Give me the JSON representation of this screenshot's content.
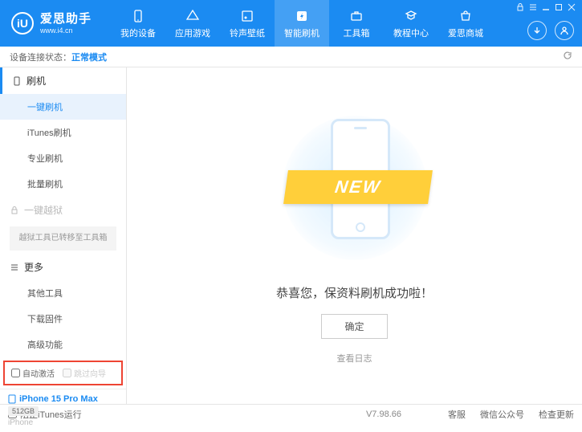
{
  "header": {
    "logo_letter": "iU",
    "title": "爱思助手",
    "url": "www.i4.cn",
    "nav": [
      {
        "label": "我的设备"
      },
      {
        "label": "应用游戏"
      },
      {
        "label": "铃声壁纸"
      },
      {
        "label": "智能刷机"
      },
      {
        "label": "工具箱"
      },
      {
        "label": "教程中心"
      },
      {
        "label": "爱思商城"
      }
    ]
  },
  "status": {
    "prefix": "设备连接状态：",
    "mode": "正常模式"
  },
  "sidebar": {
    "flash_section": "刷机",
    "items_flash": [
      "一键刷机",
      "iTunes刷机",
      "专业刷机",
      "批量刷机"
    ],
    "jailbreak_section": "一键越狱",
    "jailbreak_note": "越狱工具已转移至工具箱",
    "more_section": "更多",
    "items_more": [
      "其他工具",
      "下载固件",
      "高级功能"
    ],
    "cb_auto_activate": "自动激活",
    "cb_skip_guide": "跳过向导",
    "device_name": "iPhone 15 Pro Max",
    "device_storage": "512GB",
    "device_type": "iPhone"
  },
  "main": {
    "ribbon": "NEW",
    "success": "恭喜您，保资料刷机成功啦！",
    "ok": "确定",
    "log": "查看日志"
  },
  "footer": {
    "block_itunes": "阻止iTunes运行",
    "version": "V7.98.66",
    "links": [
      "客服",
      "微信公众号",
      "检查更新"
    ]
  }
}
